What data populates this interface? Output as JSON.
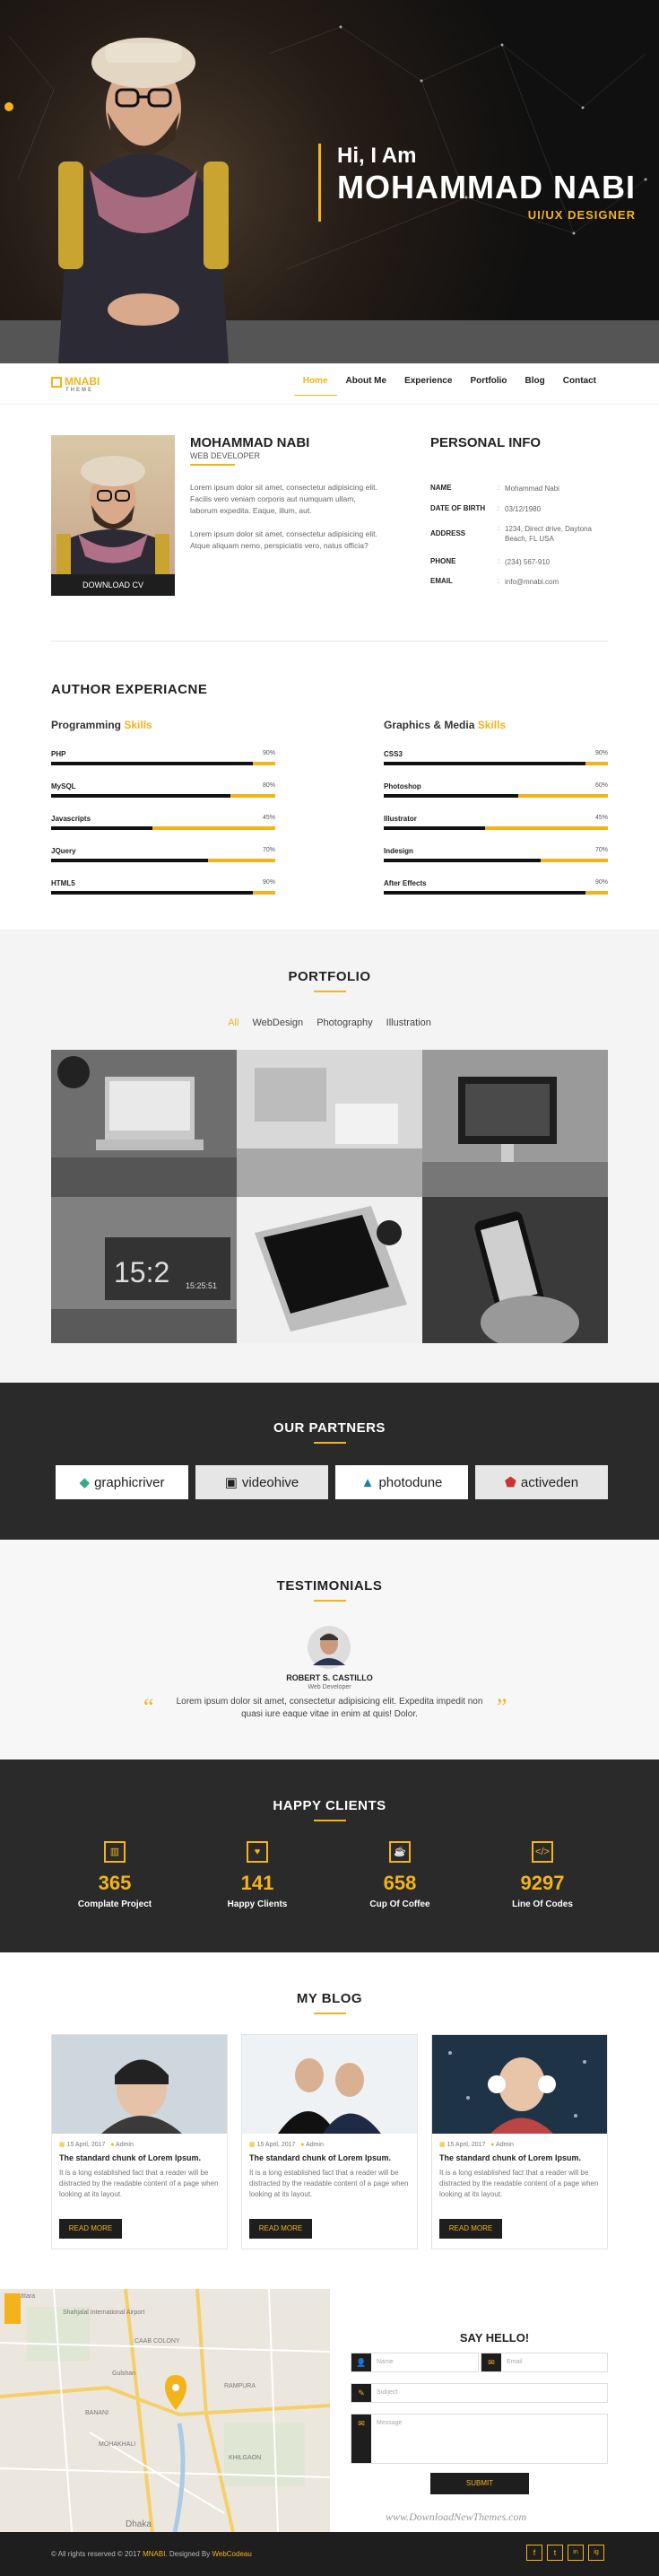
{
  "hero": {
    "greeting": "Hi, I Am",
    "name": "MOHAMMAD NABI",
    "role": "UI/UX DESIGNER"
  },
  "nav": {
    "logo": "MNABI",
    "logo_sub": "THEME",
    "links": [
      "Home",
      "About Me",
      "Experience",
      "Portfolio",
      "Blog",
      "Contact"
    ],
    "active": "Home"
  },
  "about": {
    "name": "MOHAMMAD NABI",
    "role": "WEB DEVELOPER",
    "p1": "Lorem ipsum dolor sit amet, consectetur adipisicing elit. Facilis vero veniam corporis aut numquam ullam, laborum expedita. Eaque, illum, aut.",
    "p2": "Lorem ipsum dolor sit amet, consectetur adipisicing elit. Atque aliquam nemo, perspiciatis vero, natus officia?",
    "cv": "DOWNLOAD CV"
  },
  "pinfo": {
    "title": "PERSONAL INFO",
    "rows": [
      {
        "k": "NAME",
        "v": "Mohammad Nabi"
      },
      {
        "k": "DATE OF BIRTH",
        "v": "03/12/1980"
      },
      {
        "k": "ADDRESS",
        "v": "1234, Direct drive, Daytona Beach, FL USA"
      },
      {
        "k": "PHONE",
        "v": "(234) 567-910"
      },
      {
        "k": "EMAIL",
        "v": "info@mnabi.com"
      }
    ]
  },
  "skills": {
    "title": "AUTHOR EXPERIACNE",
    "left_head": "Programming",
    "left_hl": "Skills",
    "right_head": "Graphics & Media",
    "right_hl": "Skills",
    "left": [
      {
        "n": "PHP",
        "p": "90%",
        "v": 0.9
      },
      {
        "n": "MySQL",
        "p": "80%",
        "v": 0.8
      },
      {
        "n": "Javascripts",
        "p": "45%",
        "v": 0.45
      },
      {
        "n": "JQuery",
        "p": "70%",
        "v": 0.7
      },
      {
        "n": "HTML5",
        "p": "90%",
        "v": 0.9
      }
    ],
    "right": [
      {
        "n": "CSS3",
        "p": "90%",
        "v": 0.9
      },
      {
        "n": "Photoshop",
        "p": "60%",
        "v": 0.6
      },
      {
        "n": "Illustrator",
        "p": "45%",
        "v": 0.45
      },
      {
        "n": "Indesign",
        "p": "70%",
        "v": 0.7
      },
      {
        "n": "After Effects",
        "p": "90%",
        "v": 0.9
      }
    ]
  },
  "portfolio": {
    "title": "PORTFOLIO",
    "filters": [
      "All",
      "WebDesign",
      "Photography",
      "Illustration"
    ],
    "clock_big": "15:2",
    "clock_small": "15:25:51"
  },
  "partners": {
    "title": "OUR PARTNERS",
    "logos": [
      "graphicriver",
      "videohive",
      "photodune",
      "activeden"
    ]
  },
  "testimonials": {
    "title": "TESTIMONIALS",
    "name": "ROBERT S. CASTILLO",
    "role": "Web Developer",
    "quote": "Lorem ipsum dolor sit amet, consectetur adipisicing elit. Expedita impedit non quasi iure eaque vitae in enim at quis! Dolor.",
    "open_q": "“",
    "close_q": "”"
  },
  "happy": {
    "title": "HAPPY CLIENTS",
    "stats": [
      {
        "num": "365",
        "lab": "Complate Project",
        "icon": "chart-icon"
      },
      {
        "num": "141",
        "lab": "Happy Clients",
        "icon": "heart-icon"
      },
      {
        "num": "658",
        "lab": "Cup Of Coffee",
        "icon": "coffee-icon"
      },
      {
        "num": "9297",
        "lab": "Line Of Codes",
        "icon": "code-icon"
      }
    ]
  },
  "blog": {
    "title": "MY BLOG",
    "posts": [
      {
        "date": "15 April, 2017",
        "author": "Admin",
        "title": "The standard chunk of Lorem Ipsum.",
        "desc": "It is a long established fact that a reader will be distracted by the readable content of a page when looking at its layout.",
        "btn": "READ MORE"
      },
      {
        "date": "15 April, 2017",
        "author": "Admin",
        "title": "The standard chunk of Lorem Ipsum.",
        "desc": "It is a long established fact that a reader will be distracted by the readable content of a page when looking at its layout.",
        "btn": "READ MORE"
      },
      {
        "date": "15 April, 2017",
        "author": "Admin",
        "title": "The standard chunk of Lorem Ipsum.",
        "desc": "It is a long established fact that a reader will be distracted by the readable content of a page when looking at its layout.",
        "btn": "READ MORE"
      }
    ]
  },
  "map": {
    "labels": [
      "Shahjalal International Airport",
      "CAAB COLONY",
      "Gulshan",
      "BANANI",
      "MOHAKHALI",
      "RAMPURA",
      "Dhaka",
      "KHILGAON",
      "Uttara"
    ]
  },
  "contact": {
    "title": "SAY HELLO!",
    "name_ph": "Name",
    "email_ph": "Email",
    "subject_ph": "Subject",
    "message_ph": "Message",
    "submit": "SUBMIT",
    "watermark": "www.DownloadNewThemes.com"
  },
  "footer": {
    "pre": "© All rights reserved © 2017",
    "brand": "MNABI",
    "mid": "Designed By",
    "designer": "WebCodeau",
    "social": [
      "f",
      "t",
      "in",
      "ig"
    ]
  },
  "colors": {
    "accent": "#f3b31b",
    "dark": "#2a2a2a"
  }
}
